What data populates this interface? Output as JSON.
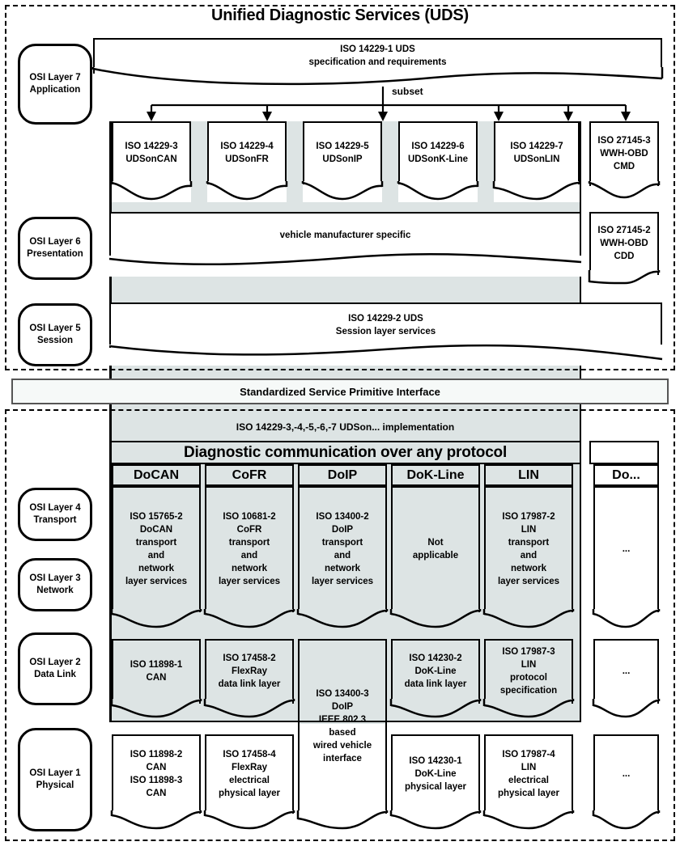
{
  "title": "Unified Diagnostic Services (UDS)",
  "top_spec": {
    "line1": "ISO 14229-1 UDS",
    "line2": "specification and requirements"
  },
  "subset_label": "subset",
  "osi_layers": [
    {
      "name": "osi-layer-7",
      "line1": "OSI Layer 7",
      "line2": "Application"
    },
    {
      "name": "osi-layer-6",
      "line1": "OSI Layer 6",
      "line2": "Presentation"
    },
    {
      "name": "osi-layer-5",
      "line1": "OSI Layer 5",
      "line2": "Session"
    },
    {
      "name": "osi-layer-4",
      "line1": "OSI Layer 4",
      "line2": "Transport"
    },
    {
      "name": "osi-layer-3",
      "line1": "OSI Layer 3",
      "line2": "Network"
    },
    {
      "name": "osi-layer-2",
      "line1": "OSI Layer 2",
      "line2": "Data Link"
    },
    {
      "name": "osi-layer-1",
      "line1": "OSI Layer 1",
      "line2": "Physical"
    }
  ],
  "application_layer": {
    "cards": [
      {
        "l1": "ISO 14229-3",
        "l2": "UDSonCAN"
      },
      {
        "l1": "ISO 14229-4",
        "l2": "UDSonFR"
      },
      {
        "l1": "ISO 14229-5",
        "l2": "UDSonIP"
      },
      {
        "l1": "ISO 14229-6",
        "l2": "UDSonK-Line"
      },
      {
        "l1": "ISO 14229-7",
        "l2": "UDSonLIN"
      }
    ],
    "wwh_obd_cmd": {
      "l1": "ISO 27145-3",
      "l2": "WWH-OBD",
      "l3": "CMD"
    }
  },
  "presentation_layer": {
    "main": "vehicle manufacturer specific",
    "wwh_obd_cdd": {
      "l1": "ISO 27145-2",
      "l2": "WWH-OBD",
      "l3": "CDD"
    }
  },
  "session_layer": {
    "line1": "ISO 14229-2 UDS",
    "line2": "Session layer services"
  },
  "sspi": "Standardized Service Primitive Interface",
  "implementation_label": "ISO 14229-3,-4,-5,-6,-7 UDSon... implementation",
  "diagnostic_banner": "Diagnostic communication over any protocol",
  "protocol_headers": [
    "DoCAN",
    "CoFR",
    "DoIP",
    "DoK-Line",
    "LIN",
    "Do..."
  ],
  "transport_network_layer": {
    "cards": [
      {
        "text": "ISO 15765-2\nDoCAN\ntransport\nand\nnetwork\nlayer services"
      },
      {
        "text": "ISO 10681-2\nCoFR\ntransport\nand\nnetwork\nlayer services"
      },
      {
        "text": "ISO 13400-2\nDoIP\ntransport\nand\nnetwork\nlayer services"
      },
      {
        "text": "Not\napplicable"
      },
      {
        "text": "ISO 17987-2\nLIN\ntransport\nand\nnetwork\nlayer services"
      },
      {
        "text": "..."
      }
    ]
  },
  "data_link_layer": {
    "cards": [
      {
        "text": "ISO 11898-1\nCAN"
      },
      {
        "text": "ISO 17458-2\nFlexRay\ndata link layer"
      },
      {
        "text": "ISO 14230-2\nDoK-Line\ndata link layer"
      },
      {
        "text": "ISO 17987-3\nLIN\nprotocol\nspecification"
      },
      {
        "text": "..."
      }
    ]
  },
  "doip_spanning_card": {
    "text": "ISO 13400-3\nDoIP\nIEEE 802.3\nbased\nwired vehicle\ninterface"
  },
  "physical_layer": {
    "cards": [
      {
        "text": "ISO 11898-2\nCAN\nISO 11898-3\nCAN"
      },
      {
        "text": "ISO 17458-4\nFlexRay\nelectrical\nphysical layer"
      },
      {
        "text": "ISO 14230-1\nDoK-Line\nphysical layer"
      },
      {
        "text": "ISO 17987-4\nLIN\nelectrical\nphysical layer"
      },
      {
        "text": "..."
      }
    ]
  },
  "colors": {
    "shade": "#dde4e4",
    "stroke": "#000000",
    "background": "#ffffff",
    "sspi_fill": "#f6f9f8"
  }
}
